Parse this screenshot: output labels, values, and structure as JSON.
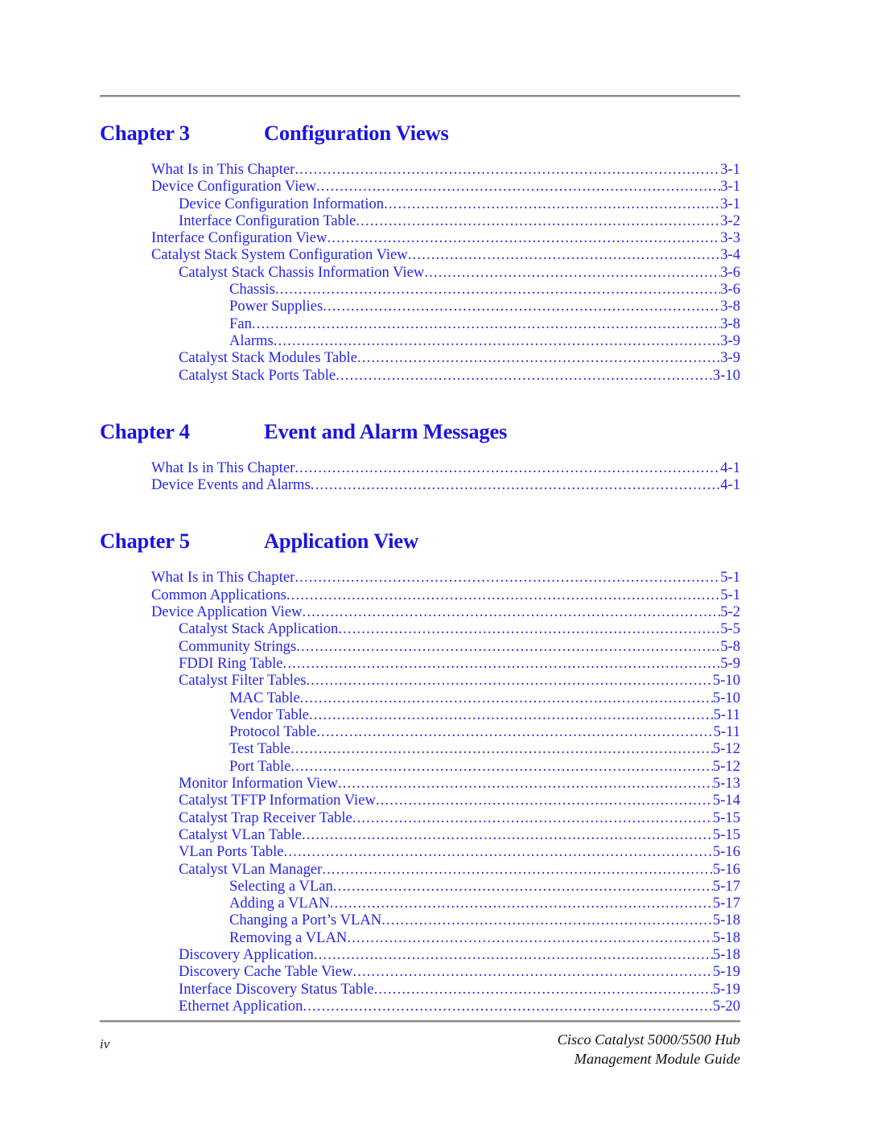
{
  "document": {
    "footer_page_number": "iv",
    "footer_title_line1": "Cisco Catalyst 5000/5500 Hub",
    "footer_title_line2": "Management Module Guide",
    "heading_color": "#1a14e0",
    "entry_color": "#2424ee",
    "rule_color": "#8a8a8a"
  },
  "chapters": [
    {
      "label": "Chapter 3",
      "title": "Configuration Views",
      "entries": [
        {
          "level": 1,
          "label": "What Is in This Chapter",
          "page": "3-1"
        },
        {
          "level": 1,
          "label": "Device Configuration View",
          "page": "3-1"
        },
        {
          "level": 2,
          "label": "Device Configuration Information",
          "page": "3-1"
        },
        {
          "level": 2,
          "label": "Interface Configuration Table",
          "page": "3-2"
        },
        {
          "level": 1,
          "label": "Interface Configuration View",
          "page": "3-3"
        },
        {
          "level": 1,
          "label": "Catalyst Stack System Configuration View",
          "page": "3-4"
        },
        {
          "level": 2,
          "label": "Catalyst Stack Chassis Information View",
          "page": "3-6"
        },
        {
          "level": 3,
          "label": "Chassis",
          "page": "3-6"
        },
        {
          "level": 3,
          "label": "Power Supplies",
          "page": "3-8"
        },
        {
          "level": 3,
          "label": "Fan",
          "page": "3-8"
        },
        {
          "level": 3,
          "label": "Alarms",
          "page": "3-9"
        },
        {
          "level": 2,
          "label": "Catalyst Stack Modules Table",
          "page": "3-9"
        },
        {
          "level": 2,
          "label": "Catalyst Stack Ports Table",
          "page": "3-10"
        }
      ]
    },
    {
      "label": "Chapter 4",
      "title": "Event and Alarm Messages",
      "entries": [
        {
          "level": 1,
          "label": "What Is in This Chapter",
          "page": "4-1"
        },
        {
          "level": 1,
          "label": "Device Events and Alarms",
          "page": "4-1"
        }
      ]
    },
    {
      "label": "Chapter 5",
      "title": "Application View",
      "entries": [
        {
          "level": 1,
          "label": "What Is in This Chapter",
          "page": "5-1"
        },
        {
          "level": 1,
          "label": "Common Applications",
          "page": "5-1"
        },
        {
          "level": 1,
          "label": "Device Application View",
          "page": "5-2"
        },
        {
          "level": 2,
          "label": "Catalyst Stack Application",
          "page": "5-5"
        },
        {
          "level": 2,
          "label": "Community Strings",
          "page": "5-8"
        },
        {
          "level": 2,
          "label": "FDDI Ring Table",
          "page": "5-9"
        },
        {
          "level": 2,
          "label": "Catalyst Filter Tables",
          "page": "5-10"
        },
        {
          "level": 3,
          "label": "MAC Table",
          "page": "5-10"
        },
        {
          "level": 3,
          "label": "Vendor Table",
          "page": "5-11"
        },
        {
          "level": 3,
          "label": "Protocol Table",
          "page": "5-11"
        },
        {
          "level": 3,
          "label": "Test Table",
          "page": "5-12"
        },
        {
          "level": 3,
          "label": "Port Table",
          "page": "5-12"
        },
        {
          "level": 2,
          "label": "Monitor Information View",
          "page": "5-13"
        },
        {
          "level": 2,
          "label": "Catalyst TFTP Information View",
          "page": "5-14"
        },
        {
          "level": 2,
          "label": "Catalyst Trap Receiver Table",
          "page": "5-15"
        },
        {
          "level": 2,
          "label": "Catalyst VLan Table",
          "page": "5-15"
        },
        {
          "level": 2,
          "label": "VLan Ports Table",
          "page": "5-16"
        },
        {
          "level": 2,
          "label": "Catalyst VLan Manager",
          "page": "5-16"
        },
        {
          "level": 3,
          "label": "Selecting a VLan",
          "page": "5-17"
        },
        {
          "level": 3,
          "label": "Adding a VLAN",
          "page": "5-17"
        },
        {
          "level": 3,
          "label": "Changing a Port’s VLAN",
          "page": "5-18"
        },
        {
          "level": 3,
          "label": "Removing a VLAN",
          "page": "5-18"
        },
        {
          "level": 2,
          "label": "Discovery Application",
          "page": "5-18"
        },
        {
          "level": 2,
          "label": "Discovery Cache Table View",
          "page": "5-19"
        },
        {
          "level": 2,
          "label": "Interface Discovery Status Table",
          "page": "5-19"
        },
        {
          "level": 2,
          "label": "Ethernet Application",
          "page": "5-20"
        }
      ]
    }
  ]
}
